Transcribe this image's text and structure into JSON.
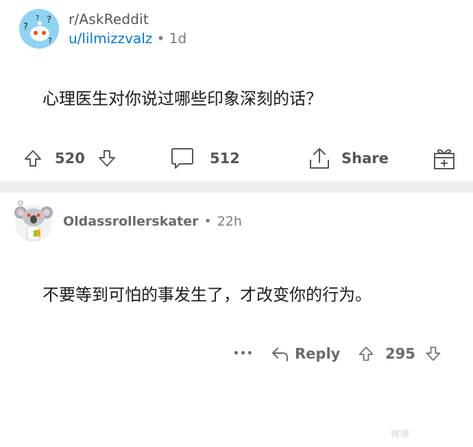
{
  "post": {
    "subreddit": "r/AskReddit",
    "author": "u/lilmizzvalz",
    "separator": "•",
    "age": "1d",
    "title": "心理医生对你说过哪些印象深刻的话？",
    "upvotes": "520",
    "comments": "512",
    "share_label": "Share"
  },
  "comment": {
    "author": "Oldassrollerskater",
    "separator": "•",
    "age": "22h",
    "body": "不要等到可怕的事发生了，才改变你的行为。",
    "more_label": "•••",
    "reply_label": "Reply",
    "votes": "295"
  },
  "watermark": "微博"
}
